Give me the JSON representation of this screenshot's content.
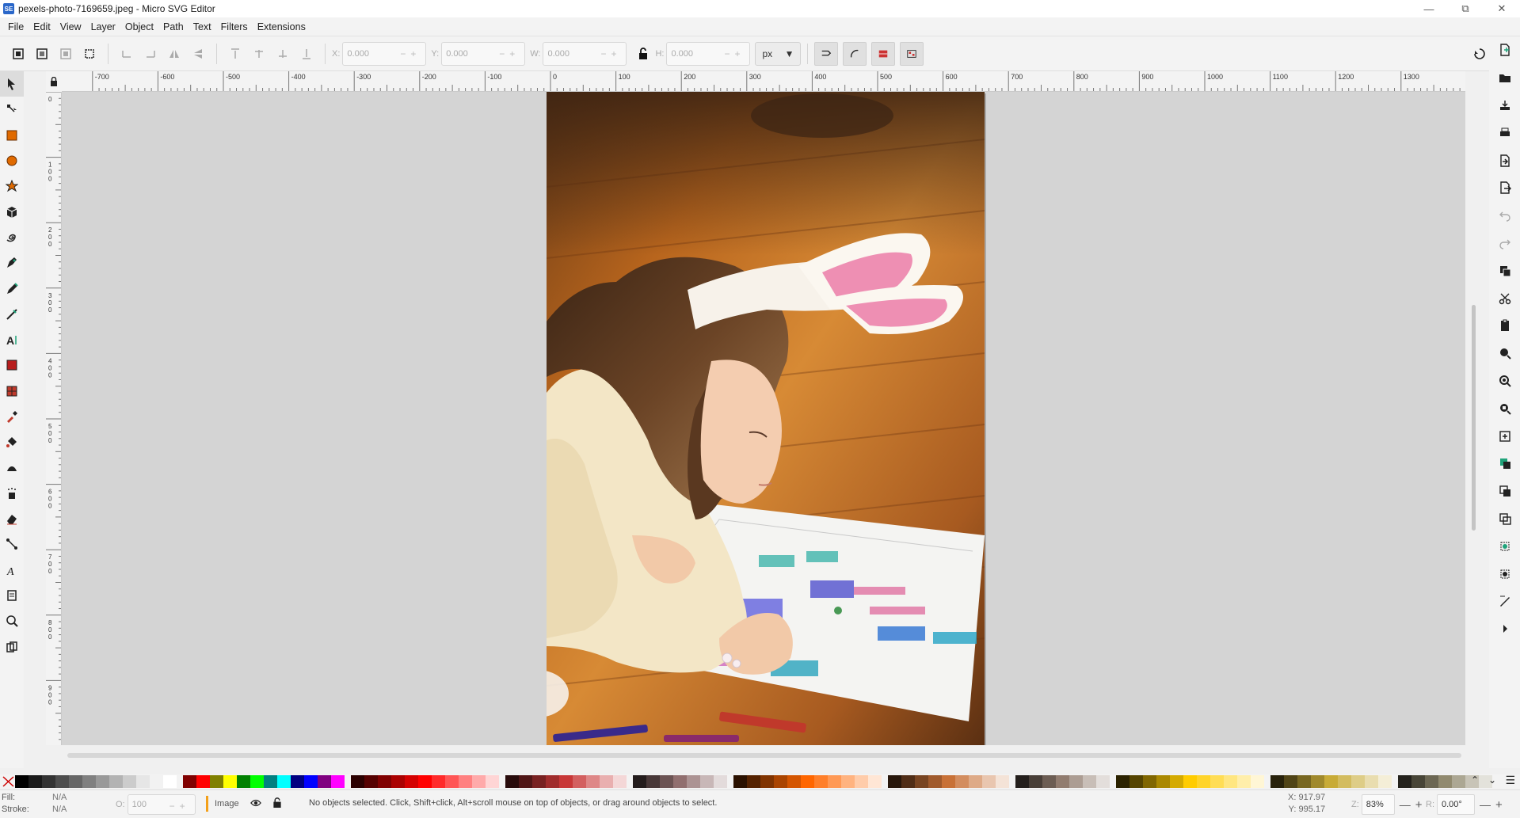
{
  "window": {
    "title": "pexels-photo-7169659.jpeg - Micro SVG Editor",
    "app_icon_text": "SE"
  },
  "menu": [
    "File",
    "Edit",
    "View",
    "Layer",
    "Object",
    "Path",
    "Text",
    "Filters",
    "Extensions"
  ],
  "toolbar": {
    "x_label": "X:",
    "x_value": "0.000",
    "y_label": "Y:",
    "y_value": "0.000",
    "w_label": "W:",
    "w_value": "0.000",
    "h_label": "H:",
    "h_value": "0.000",
    "unit": "px"
  },
  "rulers": {
    "h_ticks": [
      "-700",
      "-600",
      "-500",
      "-400",
      "-300",
      "-200",
      "-100",
      "0",
      "100",
      "200",
      "300",
      "400",
      "500",
      "600",
      "700",
      "800",
      "900",
      "1000",
      "1100",
      "1200",
      "1300"
    ],
    "v_ticks": [
      "0",
      "100",
      "200",
      "300",
      "400",
      "500",
      "600",
      "700",
      "800",
      "900"
    ]
  },
  "canvas": {
    "image_name": "pexels-photo-7169659.jpeg",
    "image_description_alt": "Photo"
  },
  "palette": {
    "colors": [
      "#000000",
      "#1a1a1a",
      "#333333",
      "#4d4d4d",
      "#666666",
      "#808080",
      "#999999",
      "#b3b3b3",
      "#cccccc",
      "#e6e6e6",
      "#f2f2f2",
      "#ffffff",
      "#800000",
      "#ff0000",
      "#808000",
      "#ffff00",
      "#008000",
      "#00ff00",
      "#008080",
      "#00ffff",
      "#000080",
      "#0000ff",
      "#800080",
      "#ff00ff",
      "#2b0000",
      "#550000",
      "#800000",
      "#aa0000",
      "#d40000",
      "#ff0000",
      "#ff2a2a",
      "#ff5555",
      "#ff8080",
      "#ffaaaa",
      "#ffd5d5",
      "#280b0b",
      "#501616",
      "#782121",
      "#a02c2c",
      "#c83737",
      "#d35f5f",
      "#de8787",
      "#e9afaf",
      "#f4d7d7",
      "#241c1c",
      "#483737",
      "#6c5353",
      "#916f6f",
      "#ac9393",
      "#c8b7b7",
      "#e3dbdb",
      "#2b1100",
      "#552200",
      "#803300",
      "#aa4400",
      "#d45500",
      "#ff6600",
      "#ff7f2a",
      "#ff9955",
      "#ffb380",
      "#ffccaa",
      "#ffe6d5",
      "#28170b",
      "#502d16",
      "#784421",
      "#a05a2c",
      "#c87137",
      "#d38d5f",
      "#deaa87",
      "#e9c6af",
      "#f4e3d7",
      "#241f1c",
      "#483e37",
      "#6c5d53",
      "#917c6f",
      "#ac9d93",
      "#c8beb7",
      "#e3dedb",
      "#2b2200",
      "#554400",
      "#806600",
      "#aa8800",
      "#d4aa00",
      "#ffcc00",
      "#ffd42a",
      "#ffdd55",
      "#ffe680",
      "#ffeeaa",
      "#fff6d5",
      "#28220b",
      "#504416",
      "#786721",
      "#a0892c",
      "#c8ab37",
      "#d3bc5f",
      "#decd87",
      "#e9ddaf",
      "#f4eed7",
      "#24221c",
      "#484537",
      "#6c6753",
      "#918a6f",
      "#aca793",
      "#c8c4b7",
      "#e3e2db"
    ]
  },
  "status": {
    "fill_label": "Fill:",
    "fill_value": "N/A",
    "stroke_label": "Stroke:",
    "stroke_value": "N/A",
    "opacity_label": "O:",
    "opacity_value": "100",
    "layer_name": "Image",
    "message": "No objects selected. Click, Shift+click, Alt+scroll mouse on top of objects, or drag around objects to select.",
    "cursor_x_label": "X:",
    "cursor_x": "917.97",
    "cursor_y_label": "Y:",
    "cursor_y": "995.17",
    "zoom_label": "Z:",
    "zoom_value": "83%",
    "rotation_label": "R:",
    "rotation_value": "0.00°"
  }
}
